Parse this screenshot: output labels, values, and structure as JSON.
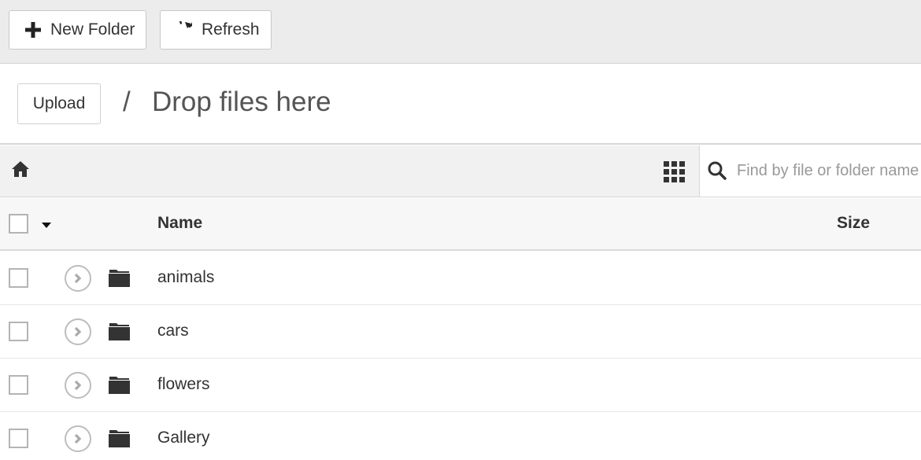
{
  "toolbar": {
    "new_folder_label": "New Folder",
    "refresh_label": "Refresh"
  },
  "upload": {
    "button_label": "Upload",
    "separator": "/",
    "drop_text": "Drop files here"
  },
  "nav": {
    "home_icon": "home-icon",
    "view_toggle_icon": "grid-view-icon"
  },
  "search": {
    "placeholder": "Find by file or folder name",
    "value": ""
  },
  "table": {
    "columns": [
      "Name",
      "Size"
    ],
    "rows": [
      {
        "name": "animals",
        "type": "folder",
        "size": ""
      },
      {
        "name": "cars",
        "type": "folder",
        "size": ""
      },
      {
        "name": "flowers",
        "type": "folder",
        "size": ""
      },
      {
        "name": "Gallery",
        "type": "folder",
        "size": ""
      }
    ]
  }
}
